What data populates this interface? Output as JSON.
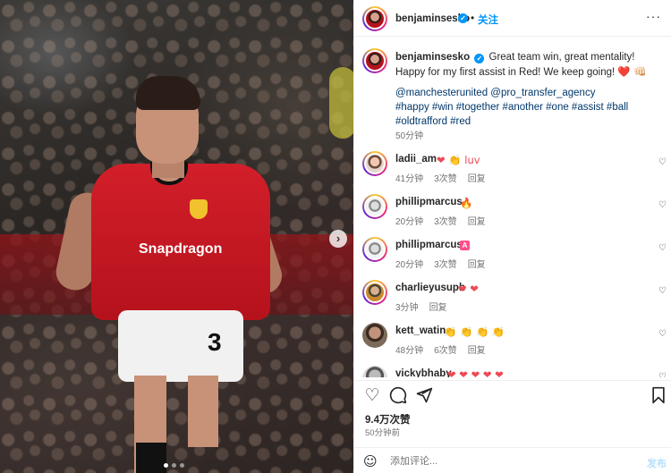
{
  "post": {
    "photo_jersey_sponsor": "Snapdragon",
    "photo_jersey_number": "3"
  },
  "header": {
    "username": "benjaminsesko",
    "verified_mark": "✓",
    "separator": "•",
    "follow_label": "关注",
    "more_label": "···"
  },
  "caption": {
    "username": "benjaminsesko",
    "text": "Great team win, great mentality! Happy for my first assist in Red! We keep going! ",
    "emojis": "❤️ 👊🏻",
    "mentions": "@manchesterunited @pro_transfer_agency",
    "hashtags": "#happy #win #together #another #one #assist #ball #oldtrafford #red",
    "time": "50分钟"
  },
  "comments": [
    {
      "user": "ladii_am",
      "text": "❤ 👏 luv",
      "time": "41分钟",
      "likes": "3次赞",
      "reply": "回复"
    },
    {
      "user": "phillipmarcus_",
      "text": "🔥",
      "time": "20分钟",
      "likes": "3次赞",
      "reply": "回复"
    },
    {
      "user": "phillipmarcus_",
      "text": "A",
      "time": "20分钟",
      "likes": "3次赞",
      "reply": "回复"
    },
    {
      "user": "charlieyusuph",
      "text": "❤ ❤",
      "time": "3分钟",
      "likes": "",
      "reply": "回复"
    },
    {
      "user": "kett_watin",
      "text": "👏 👏 👏 👏",
      "time": "48分钟",
      "likes": "6次赞",
      "reply": "回复"
    },
    {
      "user": "vickybhaby",
      "text": "❤ ❤ ❤ ❤ ❤",
      "time": "",
      "likes": "",
      "reply": ""
    }
  ],
  "actions": {
    "like_icon": "heart-icon",
    "comment_icon": "comment-icon",
    "share_icon": "share-icon",
    "save_icon": "bookmark-icon"
  },
  "likes_count": "9.4万次赞",
  "posted_ago": "50分钟前",
  "add_comment": {
    "placeholder": "添加评论...",
    "post_label": "发布"
  },
  "colors": {
    "link": "#00376b",
    "accent": "#0095f6",
    "heart": "#ed4956"
  }
}
